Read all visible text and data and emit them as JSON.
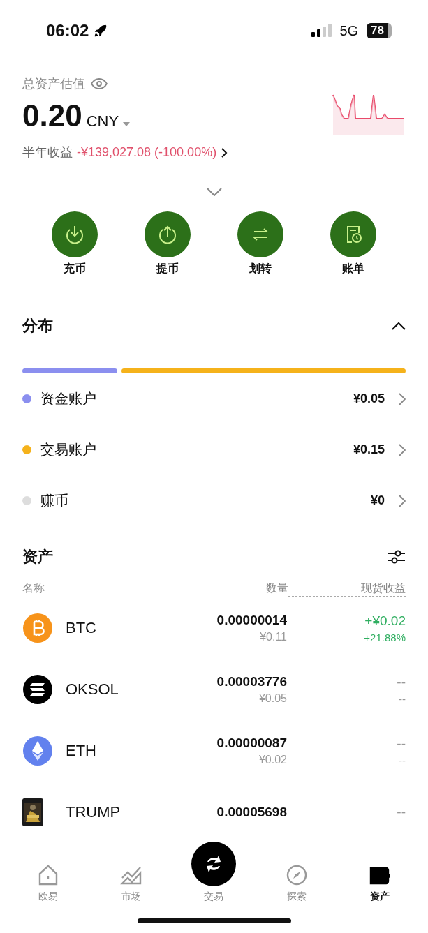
{
  "status_bar": {
    "time": "06:02",
    "network": "5G",
    "battery": "78"
  },
  "summary": {
    "label": "总资产估值",
    "amount": "0.20",
    "currency": "CNY",
    "pnl_label": "半年收益",
    "pnl_value": "-¥139,027.08 (-100.00%)"
  },
  "actions": [
    {
      "label": "充币",
      "kind": "deposit"
    },
    {
      "label": "提币",
      "kind": "withdraw"
    },
    {
      "label": "划转",
      "kind": "transfer"
    },
    {
      "label": "账单",
      "kind": "bill"
    }
  ],
  "distribution": {
    "title": "分布",
    "expanded": true,
    "accounts": [
      {
        "name": "资金账户",
        "value": "¥0.05",
        "color": "#8b8fef"
      },
      {
        "name": "交易账户",
        "value": "¥0.15",
        "color": "#f5b21b"
      },
      {
        "name": "赚币",
        "value": "¥0",
        "color": "#dddddd"
      }
    ]
  },
  "assets": {
    "title": "资产",
    "columns": [
      "名称",
      "数量",
      "现货收益"
    ],
    "rows": [
      {
        "symbol": "BTC",
        "kind": "btc",
        "amount": "0.00000014",
        "value": "¥0.11",
        "pnl": "+¥0.02",
        "pnl_pct": "+21.88%"
      },
      {
        "symbol": "OKSOL",
        "kind": "sol",
        "amount": "0.00003776",
        "value": "¥0.05",
        "pnl": "--",
        "pnl_pct": "--"
      },
      {
        "symbol": "ETH",
        "kind": "eth",
        "amount": "0.00000087",
        "value": "¥0.02",
        "pnl": "--",
        "pnl_pct": "--"
      },
      {
        "symbol": "TRUMP",
        "kind": "picture",
        "amount": "0.00005698",
        "pnl": "--"
      }
    ]
  },
  "tabs": [
    {
      "label": "欧易",
      "kind": "home",
      "selected": false
    },
    {
      "label": "市场",
      "kind": "market",
      "selected": false
    },
    {
      "label": "交易",
      "kind": "trade",
      "selected": false
    },
    {
      "label": "探索",
      "kind": "explore",
      "selected": false
    },
    {
      "label": "资产",
      "kind": "assets",
      "selected": true
    }
  ]
}
